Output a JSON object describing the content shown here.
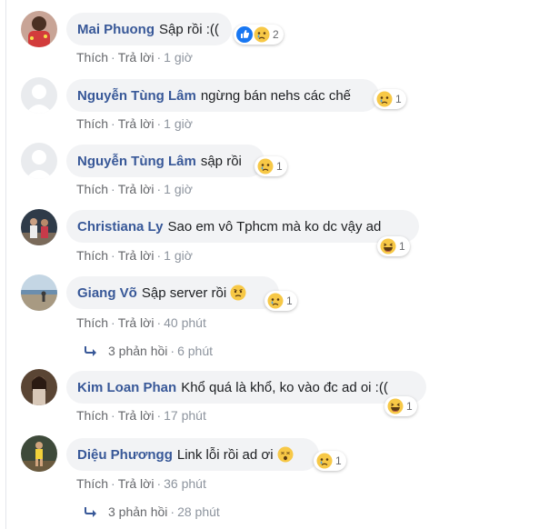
{
  "comments": [
    {
      "name": "Mai Phuong",
      "text": "Sập rồi :((",
      "actions": {
        "like": "Thích",
        "reply": "Trả lời",
        "time": "1 giờ"
      },
      "reactions": {
        "count": "2",
        "types": [
          "like",
          "sad"
        ]
      }
    },
    {
      "name": "Nguyễn Tùng Lâm",
      "text": "ngừng bán nehs các chế",
      "actions": {
        "like": "Thích",
        "reply": "Trả lời",
        "time": "1 giờ"
      },
      "reactions": {
        "count": "1",
        "types": [
          "sad"
        ]
      }
    },
    {
      "name": "Nguyễn Tùng Lâm",
      "text": "sập rồi",
      "actions": {
        "like": "Thích",
        "reply": "Trả lời",
        "time": "1 giờ"
      },
      "reactions": {
        "count": "1",
        "types": [
          "sad"
        ]
      }
    },
    {
      "name": "Christiana Ly",
      "text": "Sao em vô Tphcm mà ko dc vậy ad",
      "actions": {
        "like": "Thích",
        "reply": "Trả lời",
        "time": "1 giờ"
      },
      "reactions": {
        "count": "1",
        "types": [
          "haha"
        ]
      }
    },
    {
      "name": "Giang Võ",
      "text": "Sập server rồi",
      "inline_emoji": "worried",
      "actions": {
        "like": "Thích",
        "reply": "Trả lời",
        "time": "40 phút"
      },
      "reactions": {
        "count": "1",
        "types": [
          "sad"
        ]
      },
      "replies": {
        "label": "3 phản hồi",
        "time": "6 phút"
      }
    },
    {
      "name": "Kim Loan Phan",
      "text": "Khổ quá là khổ, ko vào đc ad oi :((",
      "actions": {
        "like": "Thích",
        "reply": "Trả lời",
        "time": "17 phút"
      },
      "reactions": {
        "count": "1",
        "types": [
          "haha"
        ]
      }
    },
    {
      "name": "Diệu Phươngg",
      "text": "Link lỗi rồi ad ơi",
      "inline_emoji": "dizzy",
      "actions": {
        "like": "Thích",
        "reply": "Trả lời",
        "time": "36 phút"
      },
      "reactions": {
        "count": "1",
        "types": [
          "sad"
        ]
      },
      "replies": {
        "label": "3 phản hồi",
        "time": "28 phút"
      }
    }
  ],
  "separator": "·",
  "colors": {
    "author": "#385898",
    "bubble": "#f2f3f5",
    "meta": "#8d949e",
    "like_blue": "#1877f2",
    "emoji_yellow": "#f7c846"
  }
}
